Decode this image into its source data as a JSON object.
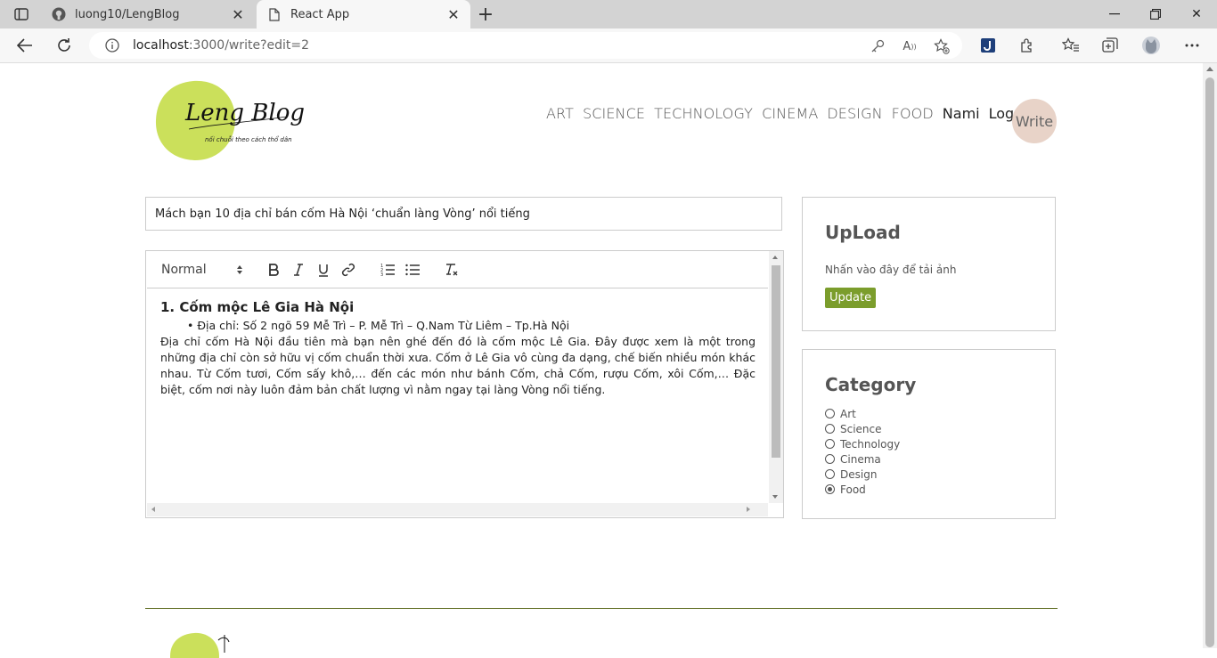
{
  "browser": {
    "tabs": [
      {
        "title": "luong10/LengBlog",
        "active": false
      },
      {
        "title": "React App",
        "active": true
      }
    ],
    "address": {
      "host": "localhost",
      "rest": ":3000/write?edit=2"
    }
  },
  "site": {
    "logo": {
      "brand": "Leng Blog",
      "tagline": "nối chuỗi theo cách thổ dân"
    },
    "nav": {
      "categories": [
        "ART",
        "SCIENCE",
        "TECHNOLOGY",
        "CINEMA",
        "DESIGN",
        "FOOD"
      ],
      "user": "Nami",
      "logout": "Logout",
      "write": "Write"
    },
    "post": {
      "title": "Mách bạn 10 địa chỉ bán cốm Hà Nội ‘chuẩn làng Vòng’ nổi tiếng",
      "toolbar": {
        "header_select": "Normal"
      },
      "content": {
        "heading": "1. Cốm mộc Lê Gia Hà Nội",
        "bullet": "Địa chỉ: Số 2 ngõ 59 Mễ Trì – P. Mễ Trì – Q.Nam Từ Liêm – Tp.Hà Nội",
        "paragraph": "Địa chỉ cốm Hà Nội đầu tiên mà bạn nên ghé đến đó là cốm mộc Lê Gia. Đây được xem là một trong những địa chỉ còn sở hữu vị cốm chuẩn thời xưa. Cốm ở Lê Gia vô cùng đa dạng, chế biến nhiều món khác nhau. Từ Cốm tươi, Cốm sấy khô,… đến các món như bánh Cốm, chả Cốm, rượu Cốm, xôi Cốm,… Đặc biệt, cốm nơi này luôn đảm bản chất lượng vì nằm ngay tại làng Vòng nổi tiếng."
      }
    },
    "upload": {
      "title": "UpLoad",
      "hint": "Nhấn vào đây để tải ảnh",
      "button": "Update"
    },
    "category": {
      "title": "Category",
      "options": [
        "Art",
        "Science",
        "Technology",
        "Cinema",
        "Design",
        "Food"
      ],
      "selected": "Food"
    }
  }
}
